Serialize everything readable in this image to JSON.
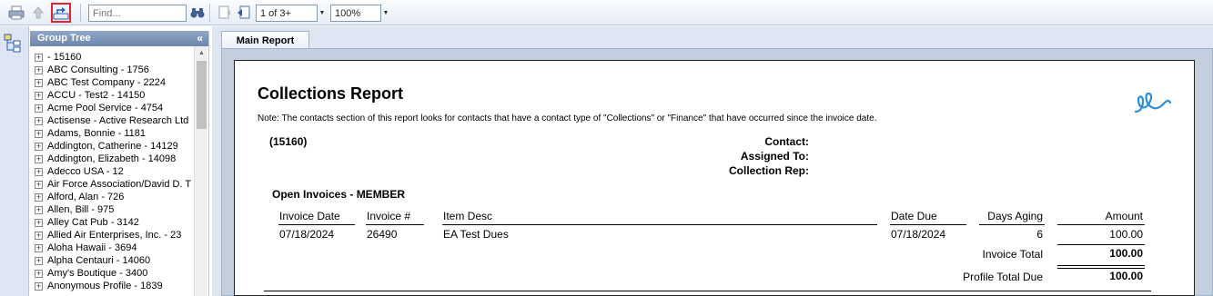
{
  "toolbar": {
    "find_placeholder": "Find...",
    "page_indicator": "1 of 3+",
    "zoom": "100%"
  },
  "group_tree": {
    "title": "Group Tree",
    "collapse_glyph": "«",
    "items": [
      " - 15160",
      "ABC Consulting - 1756",
      "ABC Test Company - 2224",
      "ACCU - Test2 - 14150",
      "Acme Pool Service - 4754",
      "Actisense - Active Research Ltd",
      "Adams, Bonnie - 1181",
      "Addington, Catherine - 14129",
      "Addington, Elizabeth - 14098",
      "Adecco USA - 12",
      "Air Force Association/David D. T",
      "Alford, Alan - 726",
      "Allen, Bill - 975",
      "Alley Cat Pub - 3142",
      "Allied Air Enterprises, Inc. - 23",
      "Aloha Hawaii - 3694",
      "Alpha Centauri - 14060",
      "Amy's Boutique - 3400",
      "Anonymous Profile - 1839"
    ]
  },
  "tabs": {
    "main": "Main Report"
  },
  "report": {
    "title": "Collections Report",
    "note": "Note:  The contacts section of this report looks for contacts that have a contact type of \"Collections\" or \"Finance\" that have occurred since the invoice date.",
    "profile_id": "(15160)",
    "contact_label": "Contact:",
    "assigned_label": "Assigned To:",
    "rep_label": "Collection Rep:",
    "section_title": "Open Invoices - MEMBER",
    "headers": {
      "invoice_date": "Invoice Date",
      "invoice_no": "Invoice #",
      "item_desc": "Item Desc",
      "date_due": "Date Due",
      "days_aging": "Days Aging",
      "amount": "Amount"
    },
    "row": {
      "invoice_date": "07/18/2024",
      "invoice_no": "26490",
      "item_desc": "EA Test Dues",
      "date_due": "07/18/2024",
      "days_aging": "6",
      "amount": "100.00"
    },
    "invoice_total_label": "Invoice Total",
    "invoice_total": "100.00",
    "profile_total_label": "Profile Total Due",
    "profile_total": "100.00"
  },
  "colors": {
    "accent": "#6d87ad",
    "highlight_border": "#e0262c",
    "logo": "#2a8fd6"
  }
}
